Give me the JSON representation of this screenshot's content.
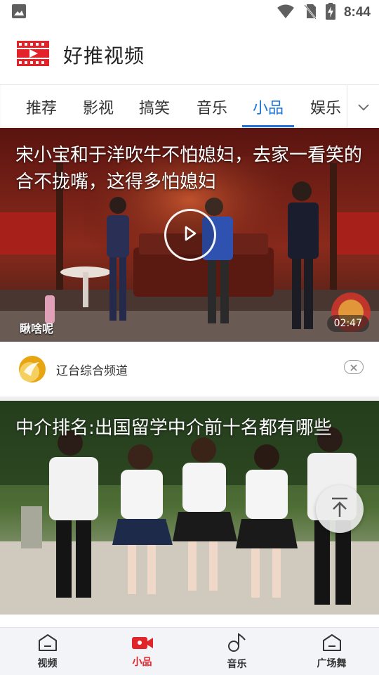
{
  "status_bar": {
    "time": "8:44"
  },
  "header": {
    "title": "好推视频"
  },
  "tabs": [
    {
      "label": "推荐"
    },
    {
      "label": "影视"
    },
    {
      "label": "搞笑"
    },
    {
      "label": "音乐"
    },
    {
      "label": "小品"
    },
    {
      "label": "娱乐"
    }
  ],
  "active_tab": "小品",
  "cards": [
    {
      "title": "宋小宝和于洋吹牛不怕媳妇，去家一看笑的合不拢嘴，这得多怕媳妇",
      "duration": "02:47",
      "watermark": "瞅啥呢",
      "source": "辽台综合频道"
    },
    {
      "title": "中介排名:出国留学中介前十名都有哪些"
    }
  ],
  "bottom_nav": [
    {
      "label": "视频",
      "icon": "home-icon"
    },
    {
      "label": "小品",
      "icon": "video-camera-icon"
    },
    {
      "label": "音乐",
      "icon": "music-note-icon"
    },
    {
      "label": "广场舞",
      "icon": "home-icon"
    }
  ],
  "colors": {
    "accent_blue": "#1a73d9",
    "accent_red": "#e0262b"
  }
}
